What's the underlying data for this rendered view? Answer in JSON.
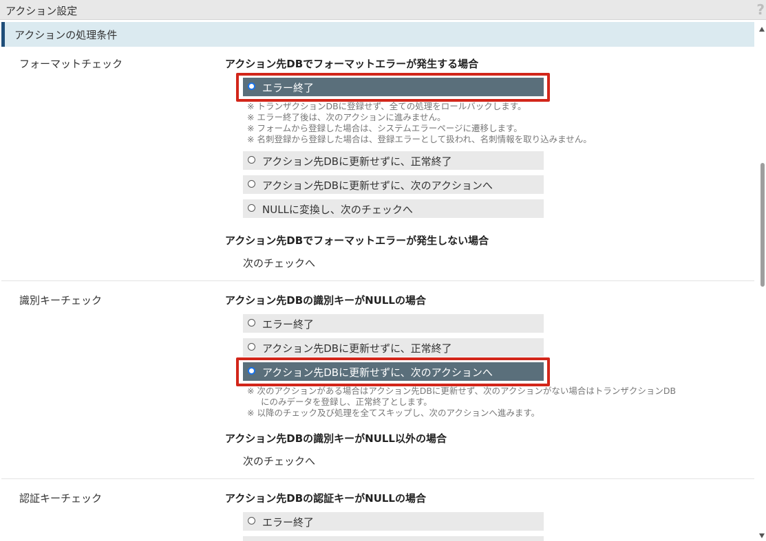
{
  "window": {
    "title": "アクション設定",
    "help_icon": "?"
  },
  "section": {
    "title": "アクションの処理条件"
  },
  "format_check": {
    "label": "フォーマットチェック",
    "cond1_title": "アクション先DBでフォーマットエラーが発生する場合",
    "options": [
      "エラー終了",
      "アクション先DBに更新せずに、正常終了",
      "アクション先DBに更新せずに、次のアクションへ",
      "NULLに変換し、次のチェックへ"
    ],
    "selected_index": 0,
    "notes": [
      "※ トランザクションDBに登録せず、全ての処理をロールバックします。",
      "※ エラー終了後は、次のアクションに進みません。",
      "※ フォームから登録した場合は、システムエラーページに遷移します。",
      "※ 名刺登録から登録した場合は、登録エラーとして扱われ、名刺情報を取り込みません。"
    ],
    "cond2_title": "アクション先DBでフォーマットエラーが発生しない場合",
    "cond2_text": "次のチェックへ"
  },
  "key_check": {
    "label": "識別キーチェック",
    "cond1_title": "アクション先DBの識別キーがNULLの場合",
    "options": [
      "エラー終了",
      "アクション先DBに更新せずに、正常終了",
      "アクション先DBに更新せずに、次のアクションへ"
    ],
    "selected_index": 2,
    "notes": [
      "※ 次のアクションがある場合はアクション先DBに更新せず、次のアクションがない場合はトランザクションDB",
      "にのみデータを登録し、正常終了とします。",
      "※ 以降のチェック及び処理を全てスキップし、次のアクションへ進みます。"
    ],
    "cond2_title": "アクション先DBの識別キーがNULL以外の場合",
    "cond2_text": "次のチェックへ"
  },
  "auth_check": {
    "label": "認証キーチェック",
    "cond1_title": "アクション先DBの認証キーがNULLの場合",
    "options": [
      "エラー終了"
    ]
  }
}
